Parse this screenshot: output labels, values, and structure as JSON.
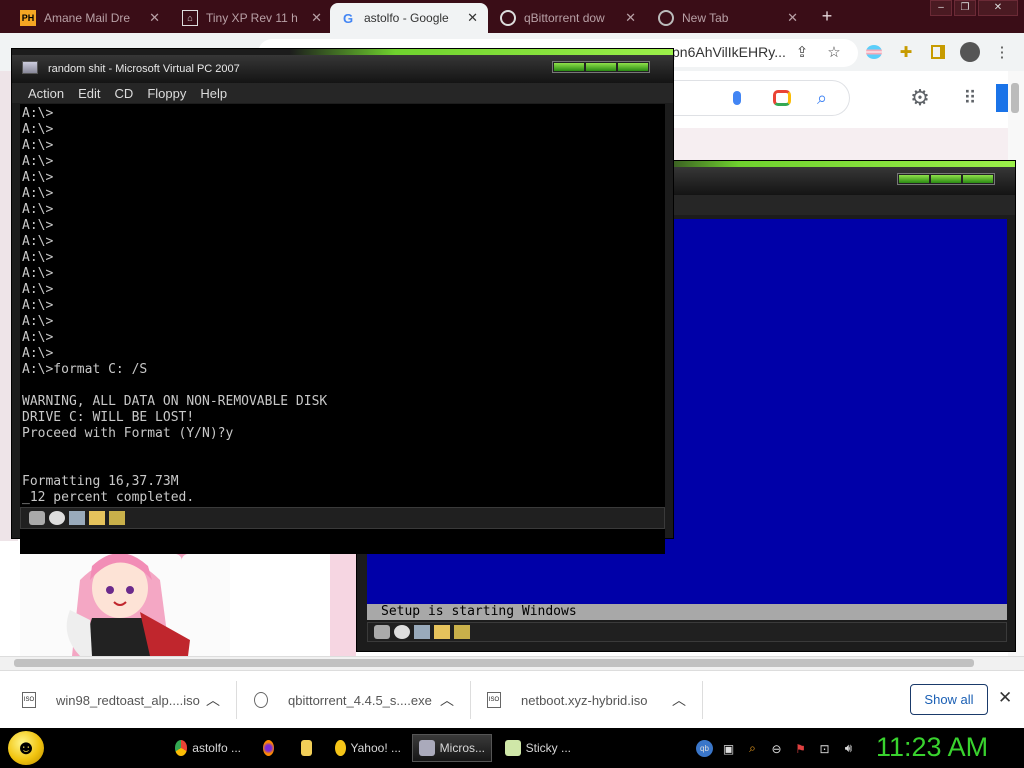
{
  "browser": {
    "tabs": [
      {
        "label": "Amane Mail Dre",
        "favicon": "PH",
        "active": false
      },
      {
        "label": "Tiny XP Rev 11 h",
        "favicon": "archive-icon",
        "active": false
      },
      {
        "label": "astolfo - Google",
        "favicon": "google-icon",
        "active": true
      },
      {
        "label": "qBittorrent dow",
        "favicon": "github-icon",
        "active": false
      },
      {
        "label": "New Tab",
        "favicon": "chrome-icon",
        "active": false
      }
    ],
    "new_tab_symbol": "+",
    "window_buttons": [
      "–",
      "❐",
      "✕"
    ],
    "url_fragment": "pn6AhVilIkEHRy...",
    "colors": {
      "frame": "#3a0d17",
      "toolbar": "#f1f3f4"
    }
  },
  "google": {
    "search_icons": [
      "mic-icon",
      "lens-icon",
      "search-icon"
    ],
    "header_icons": [
      "gear-icon",
      "apps-icon"
    ]
  },
  "vpc_window1": {
    "title": "random shit - Microsoft Virtual PC 2007",
    "menu": [
      "Action",
      "Edit",
      "CD",
      "Floppy",
      "Help"
    ],
    "dos_lines": [
      "A:\\>",
      "A:\\>",
      "A:\\>",
      "A:\\>",
      "A:\\>",
      "A:\\>",
      "A:\\>",
      "A:\\>",
      "A:\\>",
      "A:\\>",
      "A:\\>",
      "A:\\>",
      "A:\\>",
      "A:\\>",
      "A:\\>",
      "A:\\>",
      "A:\\>format C: /S",
      "",
      "WARNING, ALL DATA ON NON-REMOVABLE DISK",
      "DRIVE C: WILL BE LOST!",
      "Proceed with Format (Y/N)?y",
      "",
      "",
      "Formatting 16,37.73M",
      "_12 percent completed."
    ]
  },
  "vpc_window2": {
    "setup_status": "Setup is starting Windows",
    "screen_color": "#0000a8"
  },
  "downloads": {
    "items": [
      {
        "name": "win98_redtoast_alp....iso",
        "icon": "iso-file-icon"
      },
      {
        "name": "qbittorrent_4.4.5_s....exe",
        "icon": "installer-icon"
      },
      {
        "name": "netboot.xyz-hybrid.iso",
        "icon": "iso-file-icon"
      }
    ],
    "show_all_label": "Show all",
    "close_symbol": "✕"
  },
  "taskbar": {
    "tasks": [
      {
        "label": "astolfo ...",
        "icon": "chrome-icon"
      },
      {
        "label": "",
        "icon": "firefox-icon"
      },
      {
        "label": "",
        "icon": "folder-icon"
      },
      {
        "label": "Yahoo! ...",
        "icon": "yahoo-messenger-icon"
      },
      {
        "label": "Micros...",
        "icon": "virtual-pc-icon",
        "active": true
      },
      {
        "label": "Sticky ...",
        "icon": "sticky-notes-icon"
      }
    ],
    "clock": "11:23 AM",
    "clock_color": "#39d32e"
  }
}
